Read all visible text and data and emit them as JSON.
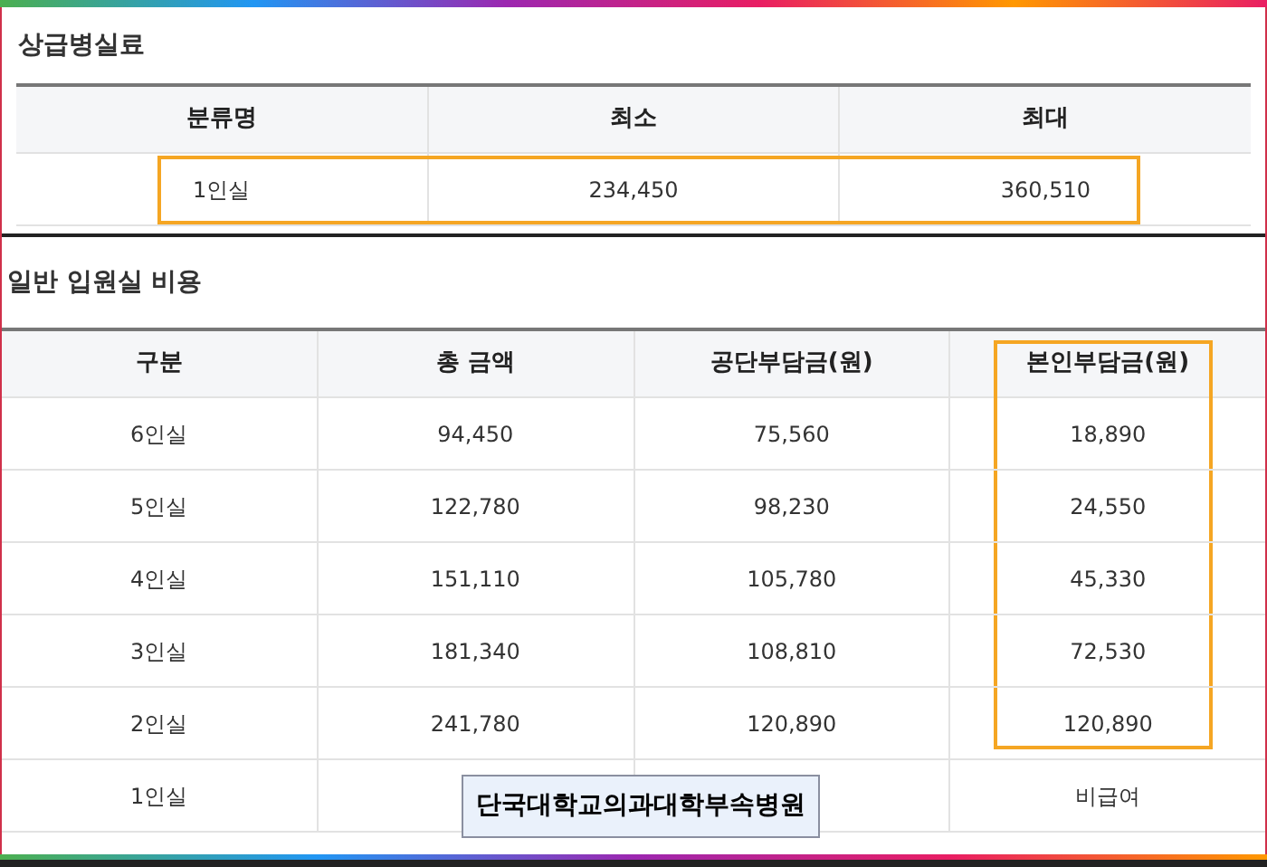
{
  "sections": [
    {
      "title": "상급병실료",
      "columns": [
        {
          "label": "분류명",
          "highlighted": false
        },
        {
          "label": "최소",
          "highlighted": false
        },
        {
          "label": "최대",
          "highlighted": false
        }
      ],
      "rows": [
        {
          "highlighted": true,
          "cells": [
            "1인실",
            "234,450",
            "360,510"
          ]
        }
      ]
    },
    {
      "title": "일반 입원실 비용",
      "columns": [
        {
          "label": "구분",
          "highlighted": false
        },
        {
          "label": "총 금액",
          "highlighted": false
        },
        {
          "label": "공단부담금(원)",
          "highlighted": false
        },
        {
          "label": "본인부담금(원)",
          "highlighted": true
        }
      ],
      "rows": [
        {
          "highlighted": false,
          "cells": [
            "6인실",
            "94,450",
            "75,560",
            "18,890"
          ]
        },
        {
          "highlighted": false,
          "cells": [
            "5인실",
            "122,780",
            "98,230",
            "24,550"
          ]
        },
        {
          "highlighted": false,
          "cells": [
            "4인실",
            "151,110",
            "105,780",
            "45,330"
          ]
        },
        {
          "highlighted": false,
          "cells": [
            "3인실",
            "181,340",
            "108,810",
            "72,530"
          ]
        },
        {
          "highlighted": false,
          "cells": [
            "2인실",
            "241,780",
            "120,890",
            "120,890"
          ]
        },
        {
          "highlighted": false,
          "cells": [
            "1인실",
            null,
            null,
            "비급여"
          ]
        }
      ]
    }
  ],
  "caption": "단국대학교의과대학부속병원"
}
